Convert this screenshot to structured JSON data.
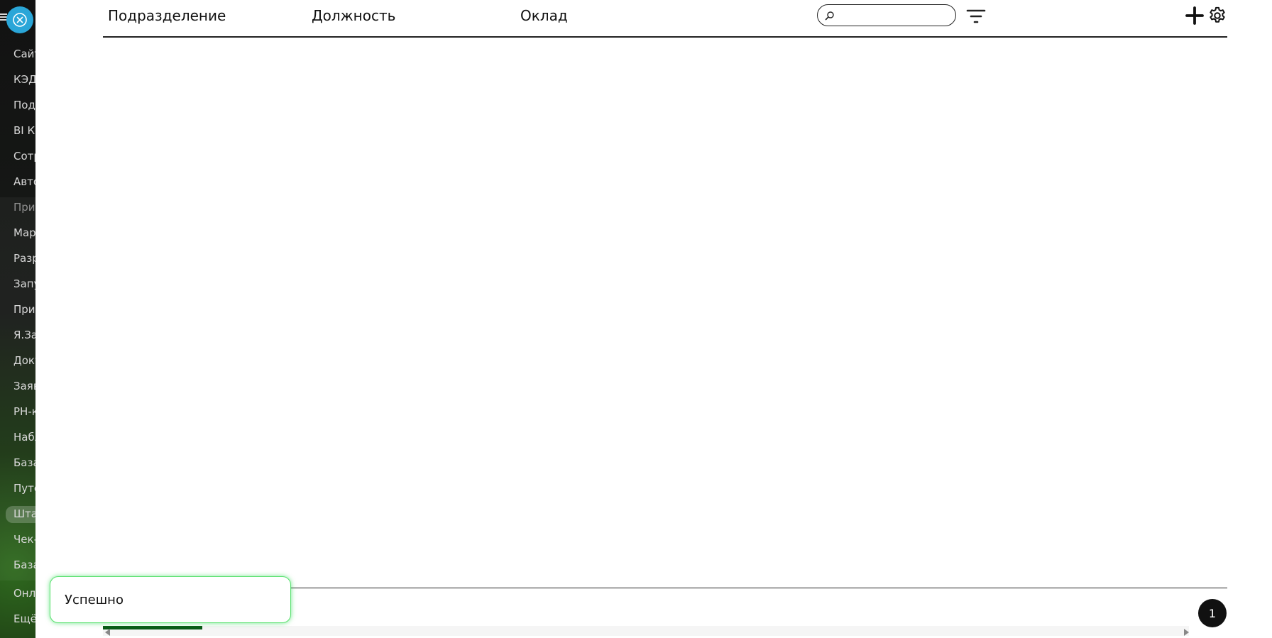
{
  "sidebar": {
    "close_button_icon": "close-icon",
    "menu_icon": "burger-menu-icon",
    "items": [
      {
        "label": "Сайт",
        "dim": false
      },
      {
        "label": "КЭДС",
        "dim": false
      },
      {
        "label": "Подр",
        "dim": false
      },
      {
        "label": "BI Ко",
        "dim": false
      },
      {
        "label": "Сотр",
        "dim": false
      },
      {
        "label": "Авто",
        "dim": false
      },
      {
        "label": "Прил",
        "dim": true
      },
      {
        "label": "Мар",
        "dim": false
      },
      {
        "label": "Разр",
        "dim": false
      },
      {
        "label": "Запу",
        "dim": false
      },
      {
        "label": "Прив",
        "dim": false
      },
      {
        "label": "Я.Зап",
        "dim": false
      },
      {
        "label": "Доку",
        "dim": false
      },
      {
        "label": "Заяв",
        "dim": false
      },
      {
        "label": "РН-к",
        "dim": false
      },
      {
        "label": "Набл",
        "dim": false
      },
      {
        "label": "База",
        "dim": false
      },
      {
        "label": "Путе",
        "dim": false
      },
      {
        "label": "Штат",
        "dim": false,
        "active": true
      },
      {
        "label": "Чек-",
        "dim": false
      },
      {
        "label": "База",
        "dim": false
      }
    ],
    "bottom_items": [
      {
        "label": "Онла"
      },
      {
        "label": "Ещё"
      }
    ]
  },
  "table": {
    "columns": [
      "Подразделение",
      "Должность",
      "Оклад"
    ],
    "search": {
      "placeholder": "",
      "value": "",
      "icon": "search-icon"
    },
    "filter_icon": "filter-icon",
    "add_icon": "plus-icon",
    "settings_icon": "gear-icon"
  },
  "pagination": {
    "current_page": "1"
  },
  "toast": {
    "message": "Успешно",
    "border_color": "#58e16e"
  },
  "colors": {
    "accent": "#2aa6d8",
    "scroll_thumb": "#0a5a18",
    "sidebar_bg": "#121212"
  }
}
